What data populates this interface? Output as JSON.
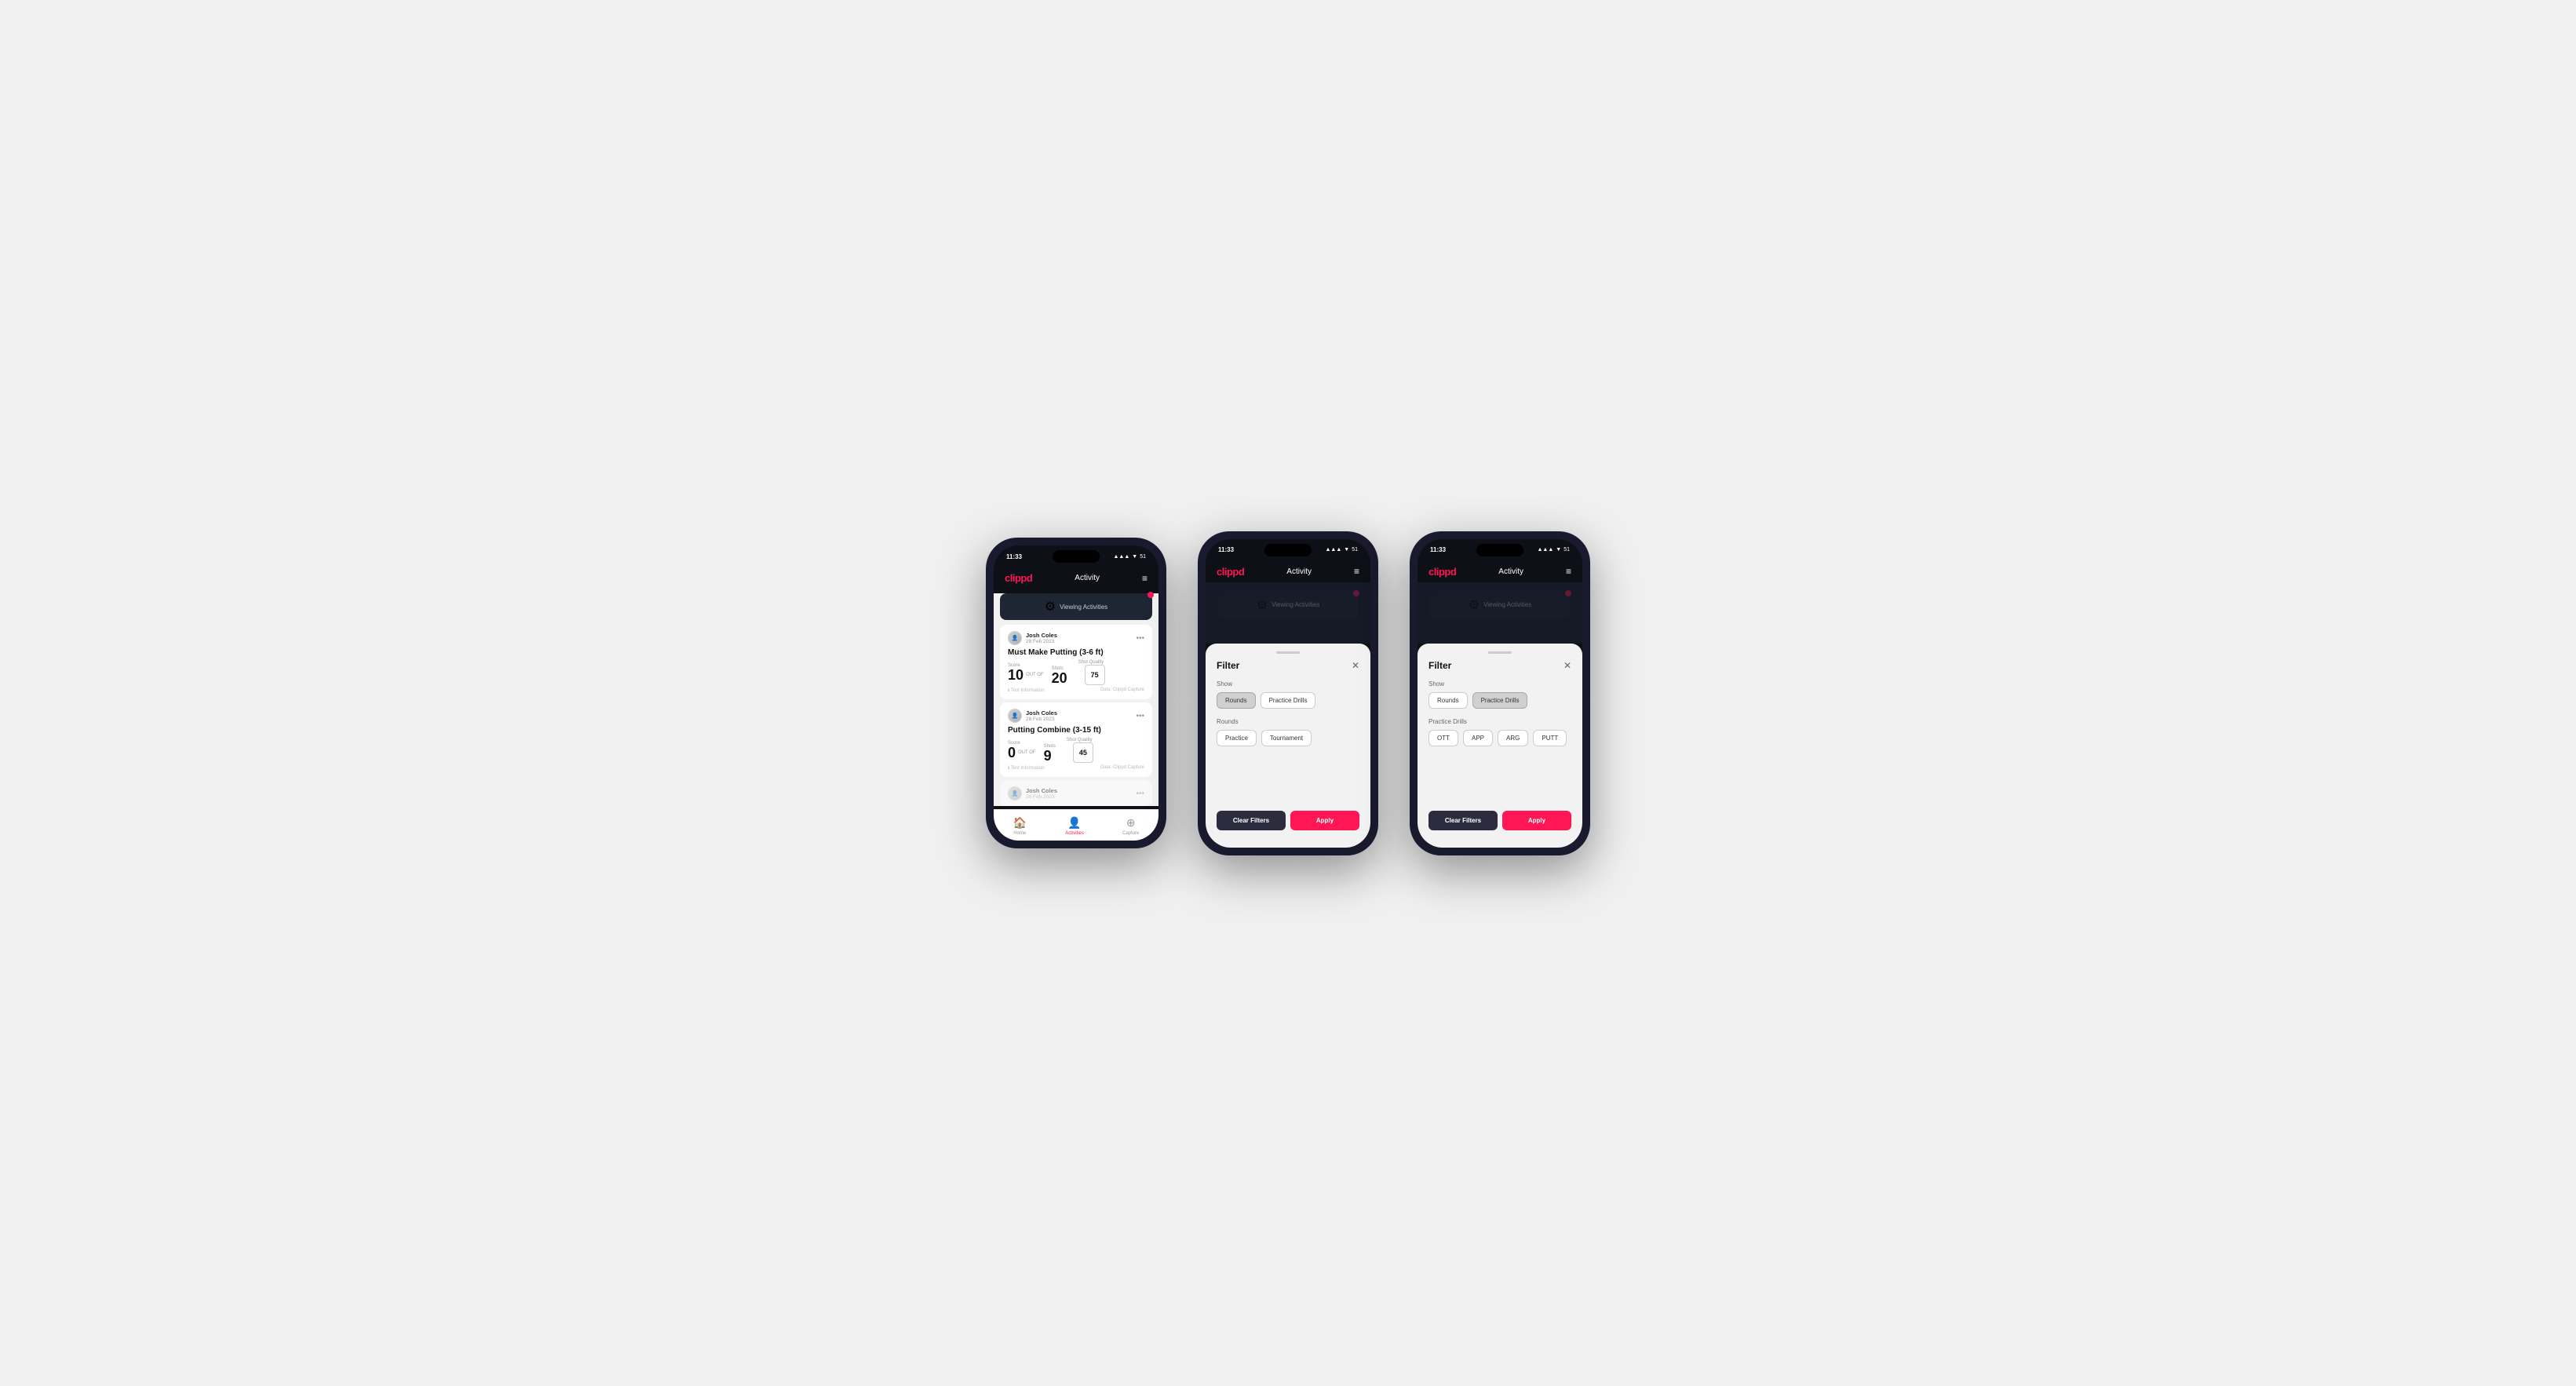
{
  "phones": [
    {
      "id": "phone1",
      "type": "activity-list",
      "statusBar": {
        "time": "11:33",
        "signal": "▲▲▲",
        "wifi": "wifi",
        "battery": "51"
      },
      "header": {
        "logo": "clippd",
        "title": "Activity",
        "menuIcon": "≡"
      },
      "viewingBanner": "Viewing Activities",
      "activities": [
        {
          "userName": "Josh Coles",
          "date": "28 Feb 2023",
          "title": "Must Make Putting (3-6 ft)",
          "scoreLabel": "Score",
          "scoreValue": "10",
          "outOf": "OUT OF",
          "shotsLabel": "Shots",
          "shotsValue": "20",
          "shotQualityLabel": "Shot Quality",
          "shotQualityValue": "75",
          "infoText": "Test Information",
          "dataText": "Data: Clippd Capture"
        },
        {
          "userName": "Josh Coles",
          "date": "28 Feb 2023",
          "title": "Putting Combine (3-15 ft)",
          "scoreLabel": "Score",
          "scoreValue": "0",
          "outOf": "OUT OF",
          "shotsLabel": "Shots",
          "shotsValue": "9",
          "shotQualityLabel": "Shot Quality",
          "shotQualityValue": "45",
          "infoText": "Test Information",
          "dataText": "Data: Clippd Capture"
        }
      ],
      "bottomNav": [
        {
          "icon": "🏠",
          "label": "Home",
          "active": false
        },
        {
          "icon": "👤",
          "label": "Activities",
          "active": true
        },
        {
          "icon": "⊕",
          "label": "Capture",
          "active": false
        }
      ]
    },
    {
      "id": "phone2",
      "type": "filter-rounds",
      "statusBar": {
        "time": "11:33",
        "signal": "▲▲▲",
        "wifi": "wifi",
        "battery": "51"
      },
      "header": {
        "logo": "clippd",
        "title": "Activity",
        "menuIcon": "≡"
      },
      "viewingBanner": "Viewing Activities",
      "filter": {
        "title": "Filter",
        "showLabel": "Show",
        "showButtons": [
          {
            "label": "Rounds",
            "active": true
          },
          {
            "label": "Practice Drills",
            "active": false
          }
        ],
        "roundsLabel": "Rounds",
        "roundButtons": [
          {
            "label": "Practice",
            "active": false
          },
          {
            "label": "Tournament",
            "active": false
          }
        ],
        "clearFilters": "Clear Filters",
        "apply": "Apply"
      }
    },
    {
      "id": "phone3",
      "type": "filter-practice",
      "statusBar": {
        "time": "11:33",
        "signal": "▲▲▲",
        "wifi": "wifi",
        "battery": "51"
      },
      "header": {
        "logo": "clippd",
        "title": "Activity",
        "menuIcon": "≡"
      },
      "viewingBanner": "Viewing Activities",
      "filter": {
        "title": "Filter",
        "showLabel": "Show",
        "showButtons": [
          {
            "label": "Rounds",
            "active": false
          },
          {
            "label": "Practice Drills",
            "active": true
          }
        ],
        "practiceDrillsLabel": "Practice Drills",
        "drillButtons": [
          {
            "label": "OTT",
            "active": false
          },
          {
            "label": "APP",
            "active": false
          },
          {
            "label": "ARG",
            "active": false
          },
          {
            "label": "PUTT",
            "active": false
          }
        ],
        "clearFilters": "Clear Filters",
        "apply": "Apply"
      }
    }
  ]
}
